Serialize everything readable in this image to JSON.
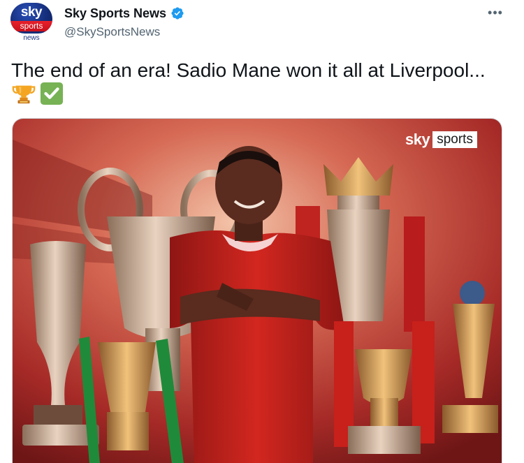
{
  "author": {
    "display_name": "Sky Sports News",
    "handle": "@SkySportsNews",
    "verified": true,
    "avatar": {
      "top_text": "sky",
      "band_text": "sports",
      "bottom_text": "news",
      "brand_blue": "#16307e",
      "brand_red": "#e8202a"
    }
  },
  "menu": {
    "icon": "more-dots-icon",
    "glyph": "•••"
  },
  "tweet": {
    "text": "The end of an era! Sadio Mane won it all at Liverpool...",
    "emojis": [
      {
        "name": "trophy-icon"
      },
      {
        "name": "check-mark-button-icon"
      }
    ]
  },
  "media": {
    "brand_overlay": {
      "sky": "sky",
      "sports": "sports"
    },
    "description_hidden": true,
    "colors": {
      "background_red": "#b8322b",
      "shirt_red": "#c8231f",
      "trophy_gold": "#c89a56",
      "ribbon_green": "#1f8a3a"
    }
  }
}
